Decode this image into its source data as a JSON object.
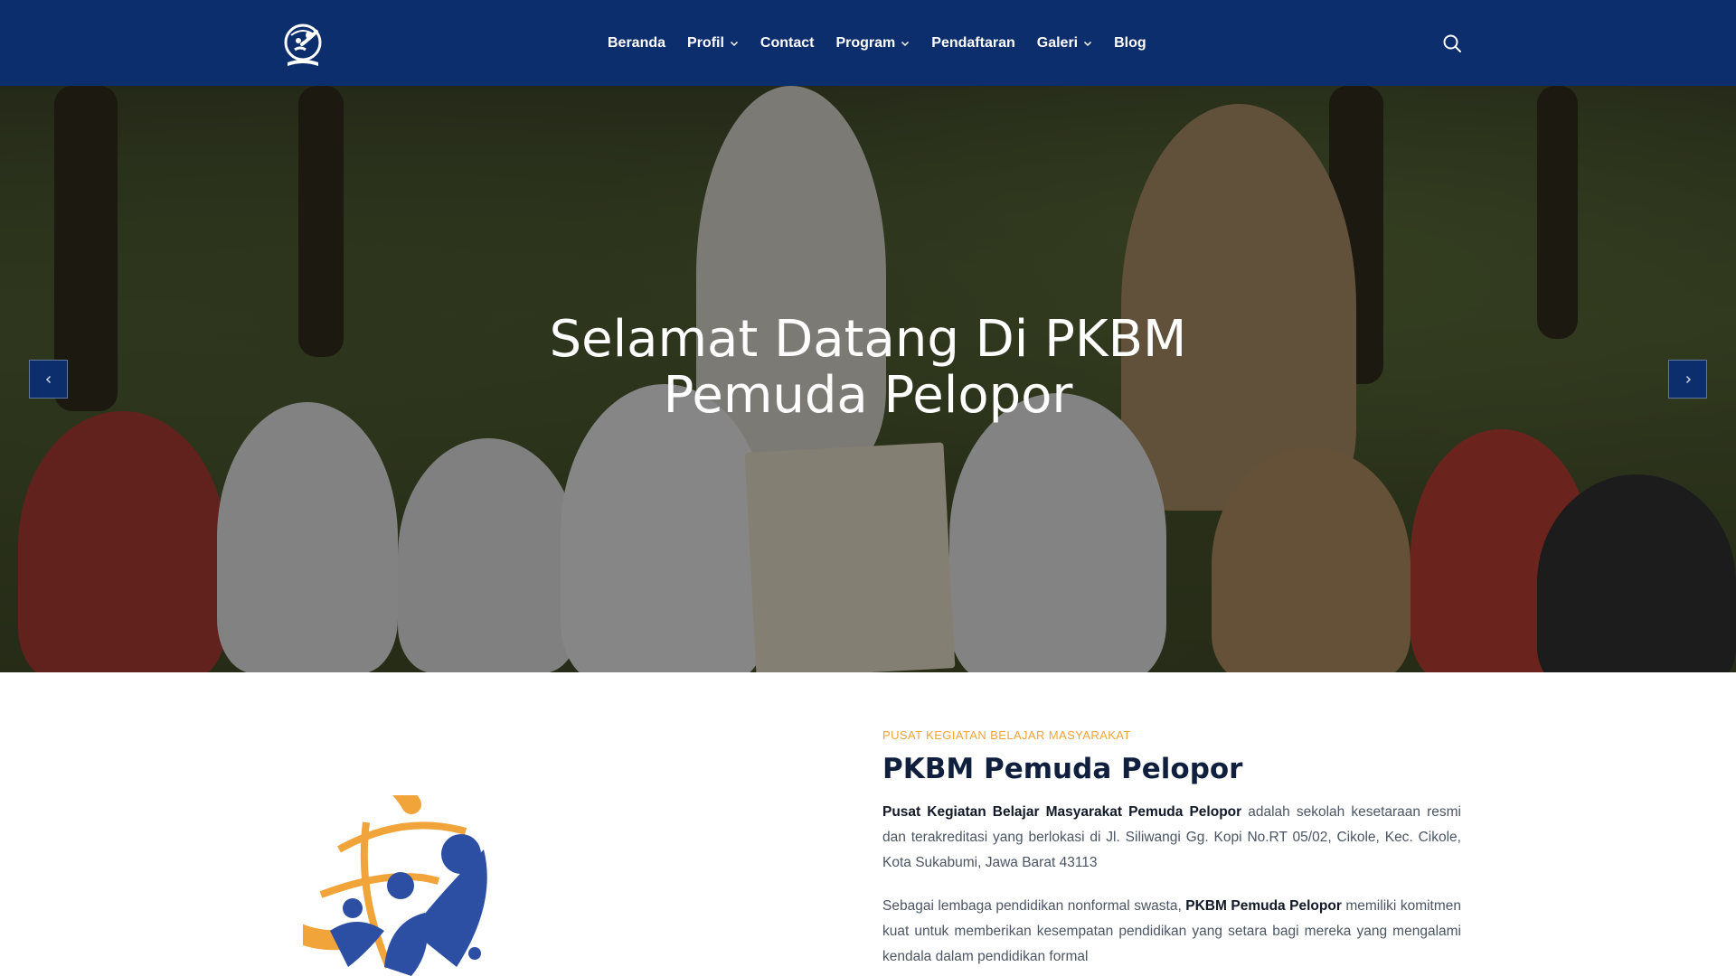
{
  "header": {
    "nav": [
      {
        "label": "Beranda",
        "dropdown": false
      },
      {
        "label": "Profil",
        "dropdown": true
      },
      {
        "label": "Contact",
        "dropdown": false
      },
      {
        "label": "Program",
        "dropdown": true
      },
      {
        "label": "Pendaftaran",
        "dropdown": false
      },
      {
        "label": "Galeri",
        "dropdown": true
      },
      {
        "label": "Blog",
        "dropdown": false
      }
    ],
    "search_icon": "search-icon",
    "background": "#0d2e6d"
  },
  "hero": {
    "title_line1": "Selamat Datang Di PKBM",
    "title_line2": "Pemuda Pelopor",
    "prev_icon": "chevron-left-icon",
    "next_icon": "chevron-right-icon"
  },
  "about": {
    "eyebrow": "PUSAT KEGIATAN BELAJAR MASYARAKAT",
    "title": "PKBM Pemuda Pelopor",
    "p1_bold": "Pusat Kegiatan Belajar Masyarakat Pemuda Pelopor",
    "p1_rest": " adalah sekolah kesetaraan resmi dan terakreditasi yang berlokasi di Jl. Siliwangi Gg. Kopi No.RT 05/02, Cikole, Kec. Cikole, Kota Sukabumi, Jawa Barat 43113",
    "p2_start": "Sebagai lembaga pendidikan nonformal swasta, ",
    "p2_bold": "PKBM Pemuda Pelopor",
    "p2_rest": " memiliki komitmen kuat untuk memberikan kesempatan pendidikan yang setara bagi mereka yang mengalami kendala dalam pendidikan formal"
  },
  "colors": {
    "brand_navy": "#0d2e6d",
    "accent_orange": "#f0a43a",
    "logo_blue": "#2d4fa3"
  }
}
